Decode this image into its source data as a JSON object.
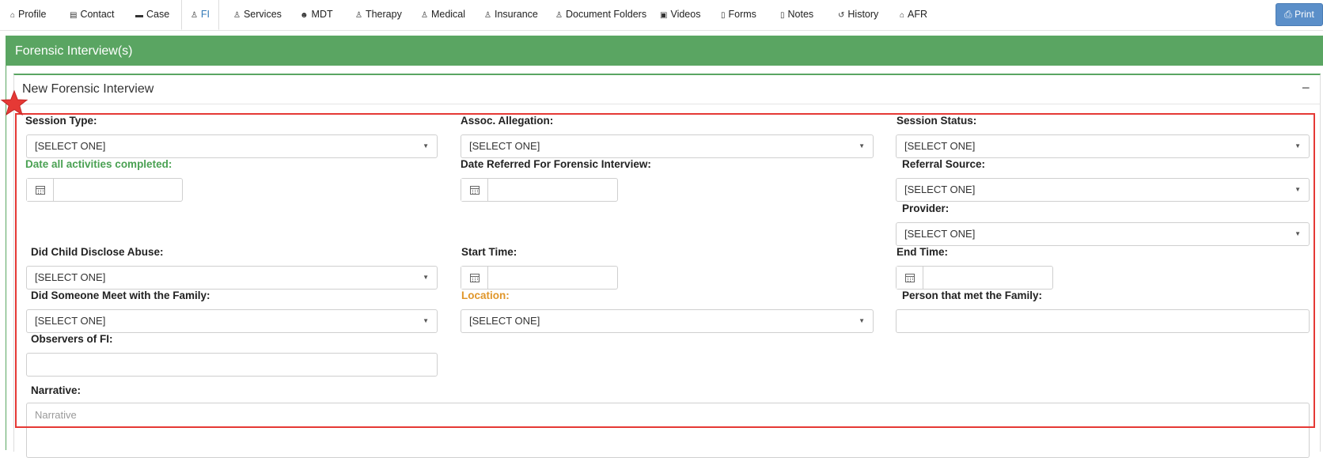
{
  "nav": {
    "tabs": [
      {
        "label": "Profile",
        "icon": "home-icon",
        "glyph": "⌂"
      },
      {
        "label": "Contact",
        "icon": "contact-card-icon",
        "glyph": "▤"
      },
      {
        "label": "Case",
        "icon": "briefcase-icon",
        "glyph": "▬"
      },
      {
        "label": "FI",
        "icon": "person-icon",
        "glyph": "♙"
      },
      {
        "label": "Services",
        "icon": "person-icon",
        "glyph": "♙"
      },
      {
        "label": "MDT",
        "icon": "users-icon",
        "glyph": "☻"
      },
      {
        "label": "Therapy",
        "icon": "person-icon",
        "glyph": "♙"
      },
      {
        "label": "Medical",
        "icon": "person-icon",
        "glyph": "♙"
      },
      {
        "label": "Insurance",
        "icon": "person-icon",
        "glyph": "♙"
      },
      {
        "label": "Document Folders",
        "icon": "person-icon",
        "glyph": "♙"
      },
      {
        "label": "Videos",
        "icon": "video-file-icon",
        "glyph": "▣"
      },
      {
        "label": "Forms",
        "icon": "document-icon",
        "glyph": "▯"
      },
      {
        "label": "Notes",
        "icon": "document-icon",
        "glyph": "▯"
      },
      {
        "label": "History",
        "icon": "history-icon",
        "glyph": "↺"
      },
      {
        "label": "AFR",
        "icon": "home-icon",
        "glyph": "⌂"
      }
    ],
    "active_tab": "FI",
    "print_label": "Print",
    "print_icon": "print-icon"
  },
  "panel": {
    "title": "Forensic Interview(s)"
  },
  "subpanel": {
    "title": "New Forensic Interview",
    "collapse_symbol": "−"
  },
  "form": {
    "session_type": {
      "label": "Session Type:",
      "value": "[SELECT ONE]"
    },
    "assoc_allegation": {
      "label": "Assoc. Allegation:",
      "value": "[SELECT ONE]"
    },
    "session_status": {
      "label": "Session Status:",
      "value": "[SELECT ONE]"
    },
    "date_all_completed": {
      "label": "Date all activities completed:",
      "value": ""
    },
    "date_referred": {
      "label": "Date Referred For Forensic Interview:",
      "value": ""
    },
    "referral_source": {
      "label": "Referral Source:",
      "value": "[SELECT ONE]"
    },
    "provider": {
      "label": "Provider:",
      "value": "[SELECT ONE]"
    },
    "did_child_disclose": {
      "label": "Did Child Disclose Abuse:",
      "value": "[SELECT ONE]"
    },
    "start_time": {
      "label": "Start Time:",
      "value": ""
    },
    "end_time": {
      "label": "End Time:",
      "value": ""
    },
    "did_someone_meet": {
      "label": "Did Someone Meet with the Family:",
      "value": "[SELECT ONE]"
    },
    "location": {
      "label": "Location:",
      "value": "[SELECT ONE]"
    },
    "person_met_family": {
      "label": "Person that met the Family:",
      "value": ""
    },
    "observers": {
      "label": "Observers of FI:",
      "value": ""
    },
    "narrative": {
      "label": "Narrative:",
      "placeholder": "Narrative"
    }
  },
  "colors": {
    "panel_green": "#5aa562",
    "label_green": "#4aa153",
    "label_orange": "#e0962a",
    "highlight_red": "#e53935",
    "print_blue": "#5b8fc9"
  }
}
